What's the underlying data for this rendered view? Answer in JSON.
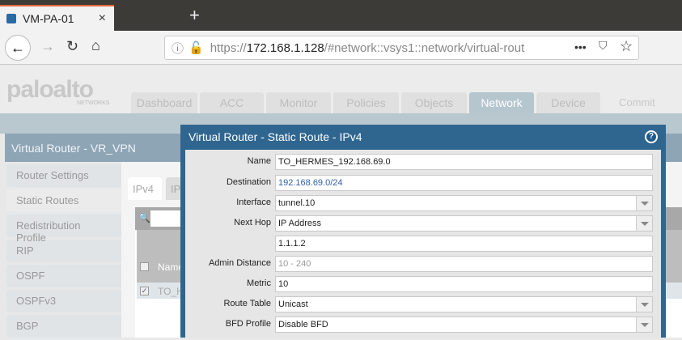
{
  "browser": {
    "tab_title": "VM-PA-01",
    "url_prefix": "https://",
    "url_host": "172.168.1.128",
    "url_path": "/#network::vsys1::network/virtual-rout",
    "close": "×",
    "new_tab": "+"
  },
  "app": {
    "logo": "paloalto",
    "logo_sub": "NETWORKS",
    "tabs": [
      "Dashboard",
      "ACC",
      "Monitor",
      "Policies",
      "Objects",
      "Network",
      "Device"
    ],
    "active_tab": "Network",
    "commit": "Commit"
  },
  "panel": {
    "title": "Virtual Router - VR_VPN",
    "sidebar": [
      "Router Settings",
      "Static Routes",
      "Redistribution Profile",
      "RIP",
      "OSPF",
      "OSPFv3",
      "BGP"
    ],
    "active": "Static Routes",
    "subtabs": [
      "IPv4",
      "IP"
    ],
    "column_name": "Name",
    "row_name": "TO_H"
  },
  "dialog": {
    "title": "Virtual Router - Static Route - IPv4",
    "fields": [
      {
        "label": "Name",
        "value": "TO_HERMES_192.168.69.0"
      },
      {
        "label": "Destination",
        "value": "192.168.69.0/24"
      },
      {
        "label": "Interface",
        "value": "tunnel.10"
      },
      {
        "label": "Next Hop",
        "value": "IP Address"
      },
      {
        "label": "",
        "value": "1.1.1.2"
      },
      {
        "label": "Admin Distance",
        "placeholder": "10 - 240"
      },
      {
        "label": "Metric",
        "value": "10"
      },
      {
        "label": "Route Table",
        "value": "Unicast"
      },
      {
        "label": "BFD Profile",
        "value": "Disable BFD"
      }
    ]
  }
}
